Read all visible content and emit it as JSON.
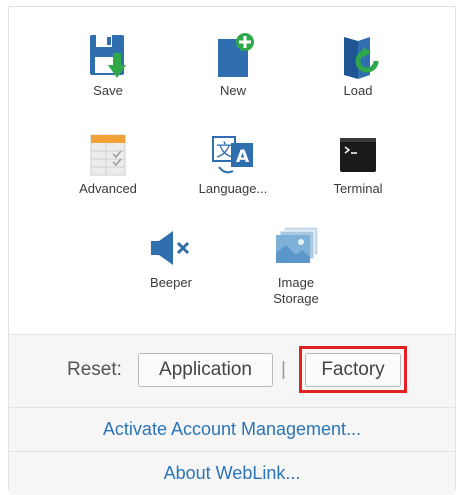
{
  "tiles": [
    {
      "label": "Save",
      "icon": "save-icon"
    },
    {
      "label": "New",
      "icon": "new-document-icon"
    },
    {
      "label": "Load",
      "icon": "load-folder-icon"
    },
    {
      "label": "Advanced",
      "icon": "advanced-table-icon"
    },
    {
      "label": "Language...",
      "icon": "language-icon"
    },
    {
      "label": "Terminal",
      "icon": "terminal-icon"
    },
    {
      "label": "Beeper",
      "icon": "speaker-mute-icon"
    },
    {
      "label": "Image\nStorage",
      "icon": "image-storage-icon"
    }
  ],
  "reset": {
    "label": "Reset:",
    "application_label": "Application",
    "separator": "|",
    "factory_label": "Factory"
  },
  "links": {
    "activate": "Activate Account Management...",
    "about": "About WebLink..."
  },
  "colors": {
    "link": "#2b74b8",
    "highlight": "#e02222",
    "icon_blue": "#2f6fb0",
    "icon_green": "#2fa84a"
  }
}
